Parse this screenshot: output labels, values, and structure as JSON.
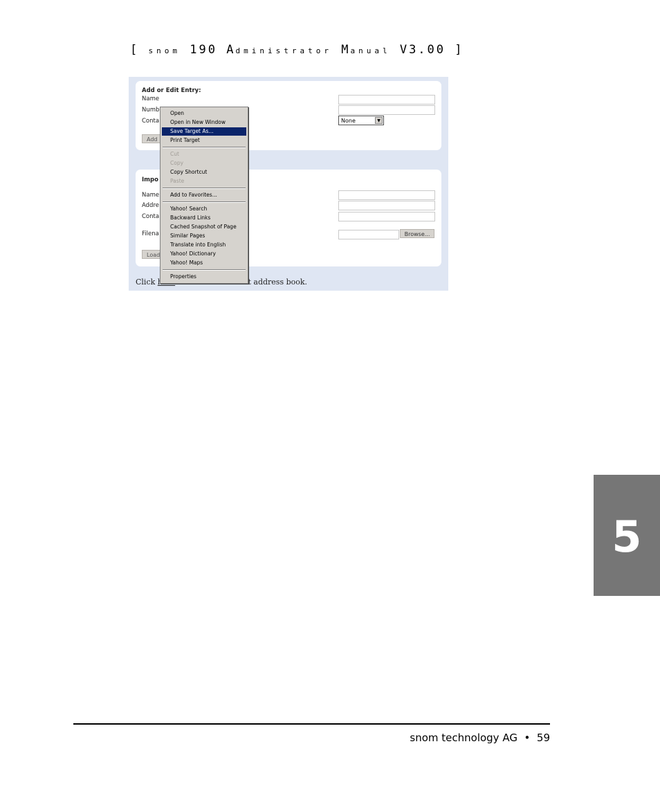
{
  "header": {
    "bracket_open": "[",
    "brand": "snom",
    "model": "190",
    "title_a_initial": "A",
    "title_a_rest": "dministrator",
    "title_m_initial": "M",
    "title_m_rest": "anual",
    "version": "V3.00",
    "bracket_close": "]"
  },
  "screenshot": {
    "panel1": {
      "heading": "Add or Edit Entry:",
      "labels": [
        "Name",
        "Numb",
        "Conta"
      ],
      "select_value": "None",
      "button_label": "Add"
    },
    "panel2": {
      "heading": "Impo",
      "labels": [
        "Name",
        "Addre",
        "Conta",
        "Filena"
      ],
      "browse_label": "Browse...",
      "button_label": "Load"
    },
    "footnote_pre": "Click ",
    "footnote_link": "here",
    "footnote_post": " to save the current address book.",
    "context_menu": [
      "Open",
      "Open in New Window",
      "Save Target As...",
      "Print Target",
      "Cut",
      "Copy",
      "Copy Shortcut",
      "Paste",
      "Add to Favorites...",
      "Yahoo! Search",
      "Backward Links",
      "Cached Snapshot of Page",
      "Similar Pages",
      "Translate into English",
      "Yahoo! Dictionary",
      "Yahoo! Maps",
      "Properties"
    ]
  },
  "chapter_tab": "5",
  "footer": {
    "company": "snom technology AG",
    "bullet": "•",
    "page": "59"
  },
  "colors": {
    "menu_highlight": "#0a246a",
    "screenshot_bg": "#dfe6f3",
    "chapter_tab_bg": "#767676"
  }
}
